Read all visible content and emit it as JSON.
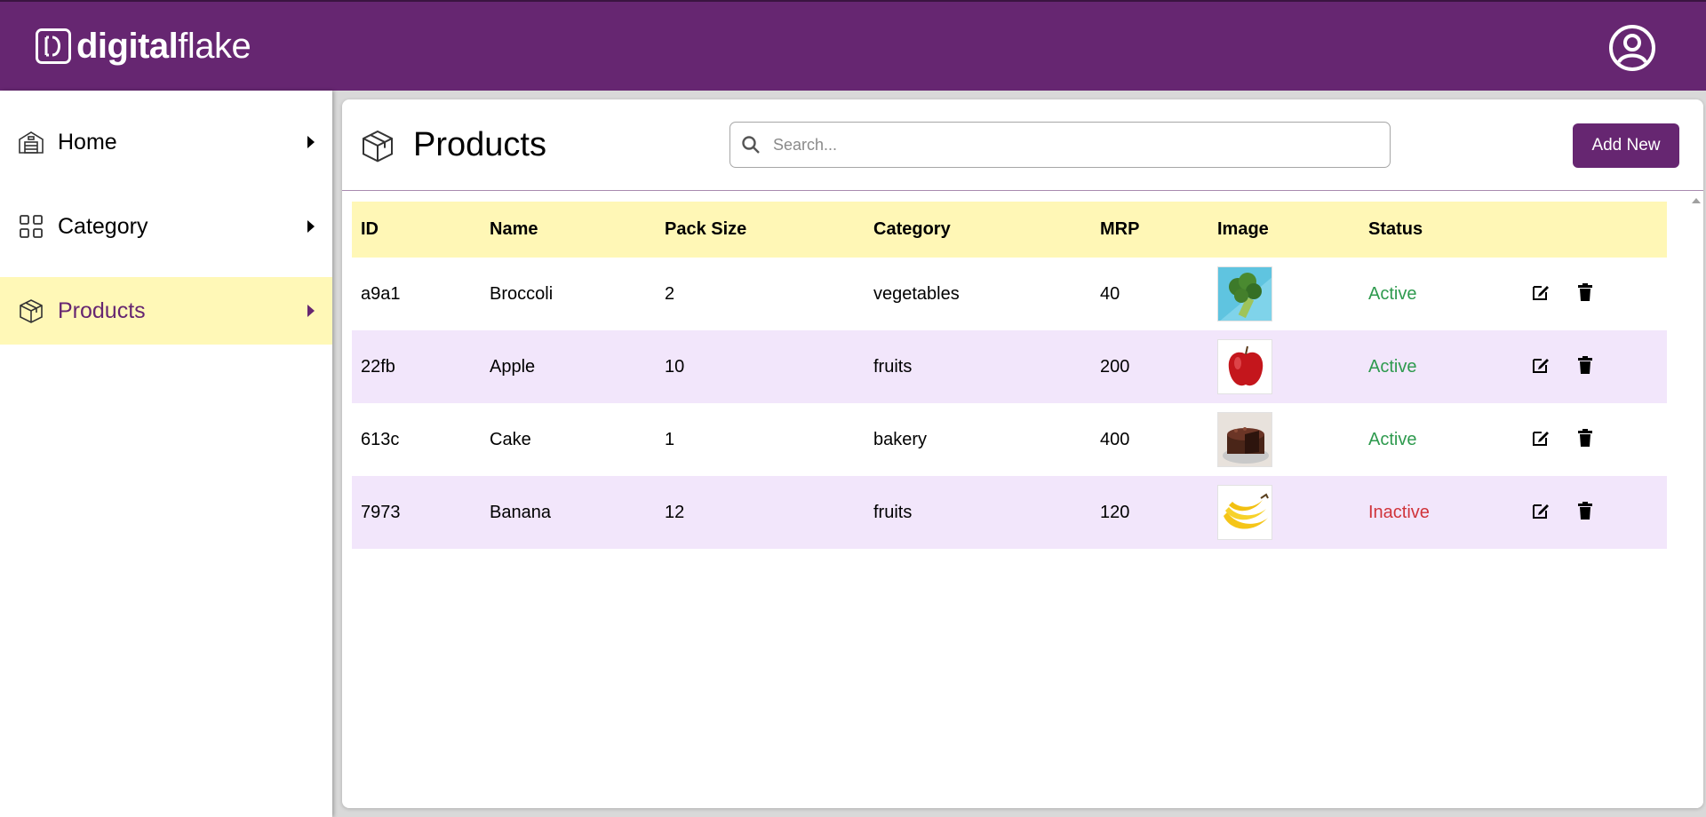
{
  "header": {
    "logo_bold": "digital",
    "logo_light": "flake",
    "logo_mark": "D",
    "profile_icon": "user-circle-icon"
  },
  "sidebar": {
    "items": [
      {
        "label": "Home",
        "icon": "warehouse-icon",
        "active": false
      },
      {
        "label": "Category",
        "icon": "grid-icon",
        "active": false
      },
      {
        "label": "Products",
        "icon": "box-icon",
        "active": true
      }
    ]
  },
  "page": {
    "title": "Products",
    "search_placeholder": "Search...",
    "add_button": "Add New"
  },
  "table": {
    "columns": [
      "ID",
      "Name",
      "Pack Size",
      "Category",
      "MRP",
      "Image",
      "Status"
    ],
    "rows": [
      {
        "id": "a9a1",
        "name": "Broccoli",
        "pack_size": "2",
        "category": "vegetables",
        "mrp": "40",
        "image": "broccoli",
        "status": "Active"
      },
      {
        "id": "22fb",
        "name": "Apple",
        "pack_size": "10",
        "category": "fruits",
        "mrp": "200",
        "image": "apple",
        "status": "Active"
      },
      {
        "id": "613c",
        "name": "Cake",
        "pack_size": "1",
        "category": "bakery",
        "mrp": "400",
        "image": "chocolate-cake",
        "status": "Active"
      },
      {
        "id": "7973",
        "name": "Banana",
        "pack_size": "12",
        "category": "fruits",
        "mrp": "120",
        "image": "banana",
        "status": "Inactive"
      }
    ]
  },
  "colors": {
    "brand": "#662671",
    "highlight": "#fff7b6",
    "row_alt": "#f2e6fb",
    "active": "#2e9a4e",
    "inactive": "#d0343a"
  }
}
